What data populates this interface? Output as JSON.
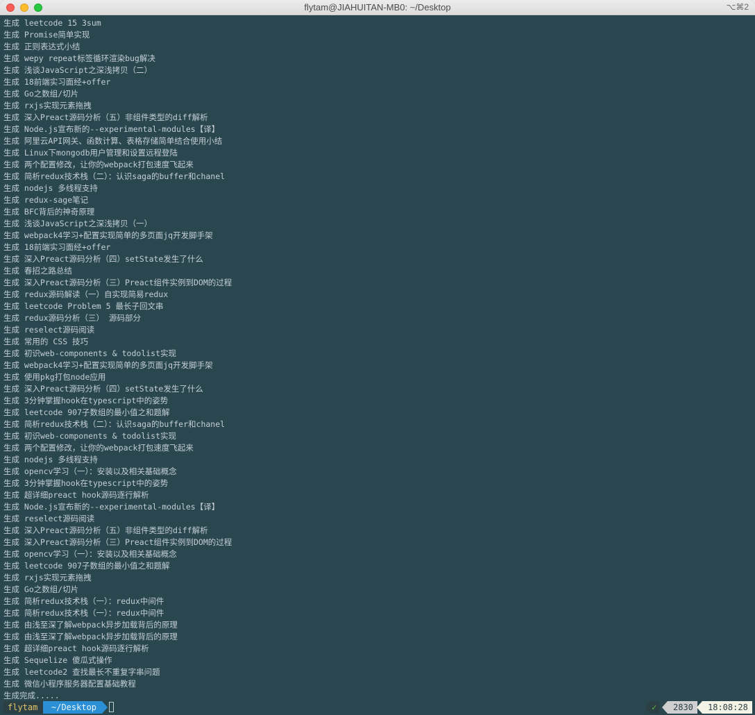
{
  "window": {
    "title": "flytam@JIAHUITAN-MB0: ~/Desktop",
    "shortcut": "⌥⌘2"
  },
  "terminal": {
    "lines": [
      "生成 leetcode 15 3sum",
      "生成 Promise简单实现",
      "生成 正则表达式小结",
      "生成 wepy repeat标签循环渲染bug解决",
      "生成 浅谈JavaScript之深浅拷贝（二）",
      "生成 18前端实习面经+offer",
      "生成 Go之数组/切片",
      "生成 rxjs实现元素拖拽",
      "生成 深入Preact源码分析（五）非组件类型的diff解析",
      "生成 Node.js宣布新的--experimental-modules【译】",
      "生成 阿里云API网关、函数计算、表格存储简单结合使用小结",
      "生成 Linux下mongodb用户管理和设置远程登陆",
      "生成 两个配置修改，让你的webpack打包速度飞起来",
      "生成 简析redux技术栈（二）：认识saga的buffer和chanel",
      "生成 nodejs 多线程支持",
      "生成 redux-sage笔记",
      "生成 BFC背后的神奇原理",
      "生成 浅谈JavaScript之深浅拷贝（一）",
      "生成 webpack4学习+配置实现简单的多页面jq开发脚手架",
      "生成 18前端实习面经+offer",
      "生成 深入Preact源码分析（四）setState发生了什么",
      "生成 春招之路总结",
      "生成 深入Preact源码分析（三）Preact组件实例到DOM的过程",
      "生成 redux源码解读（一）自实现简易redux",
      "生成 leetcode Problem 5 最长子回文串",
      "生成 redux源码分析（三） 源码部分",
      "生成 reselect源码阅读",
      "生成 常用的 CSS 技巧",
      "生成 初识web-components & todolist实现",
      "生成 webpack4学习+配置实现简单的多页面jq开发脚手架",
      "生成 使用pkg打包node应用",
      "生成 深入Preact源码分析（四）setState发生了什么",
      "生成 3分钟掌握hook在typescript中的姿势",
      "生成 leetcode 907子数组的最小值之和题解",
      "生成 简析redux技术栈（二）：认识saga的buffer和chanel",
      "生成 初识web-components & todolist实现",
      "生成 两个配置修改，让你的webpack打包速度飞起来",
      "生成 nodejs 多线程支持",
      "生成 opencv学习（一）：安装以及相关基础概念",
      "生成 3分钟掌握hook在typescript中的姿势",
      "生成 超详细preact hook源码逐行解析",
      "生成 Node.js宣布新的--experimental-modules【译】",
      "生成 reselect源码阅读",
      "生成 深入Preact源码分析（五）非组件类型的diff解析",
      "生成 深入Preact源码分析（三）Preact组件实例到DOM的过程",
      "生成 opencv学习（一）：安装以及相关基础概念",
      "生成 leetcode 907子数组的最小值之和题解",
      "生成 rxjs实现元素拖拽",
      "生成 Go之数组/切片",
      "生成 简析redux技术栈（一）：redux中间件",
      "生成 简析redux技术栈（一）：redux中间件",
      "生成 由浅至深了解webpack异步加载背后的原理",
      "生成 由浅至深了解webpack异步加载背后的原理",
      "生成 超详细preact hook源码逐行解析",
      "生成 Sequelize 傻瓜式操作",
      "生成 leetcode2 查找最长不重复字串问题",
      "生成 微信小程序服务器配置基础教程",
      "生成完成....."
    ]
  },
  "prompt": {
    "user": "flytam",
    "directory": "~/Desktop",
    "status_mark": "✓",
    "history_count": "2830",
    "time": "18:08:28"
  },
  "colors": {
    "background": "#2a4750",
    "text": "#c3ced3",
    "user_segment": "#2c3f44",
    "user_text": "#e4c56a",
    "dir_segment": "#2a8fd4",
    "status_ok": "#5fbf3a"
  }
}
